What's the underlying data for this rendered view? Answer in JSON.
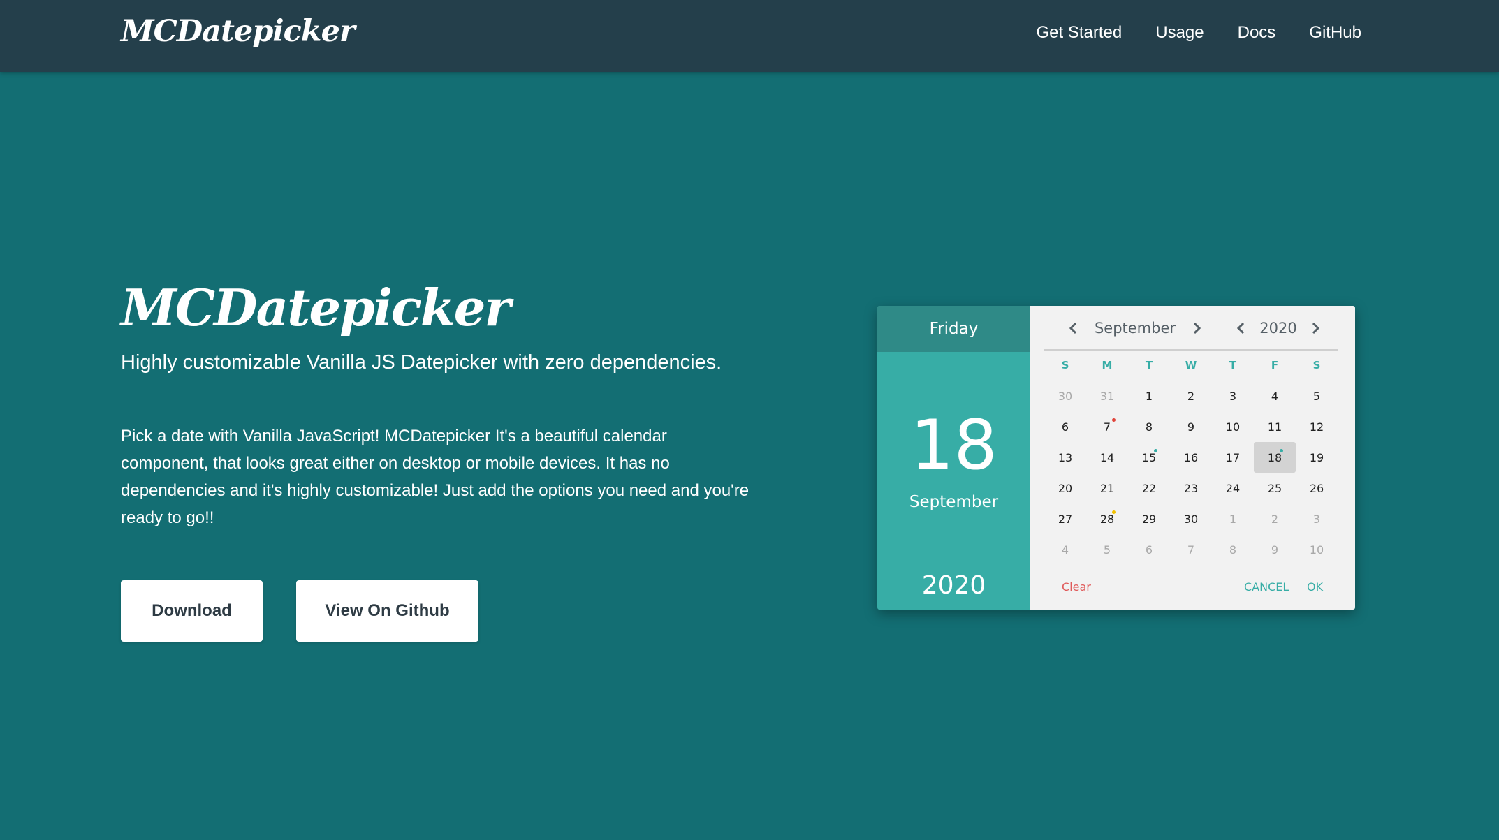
{
  "header": {
    "brand": "MCDatepicker",
    "nav": [
      "Get Started",
      "Usage",
      "Docs",
      "GitHub"
    ]
  },
  "hero": {
    "title": "MCDatepicker",
    "subtitle": "Highly customizable Vanilla JS Datepicker with zero dependencies.",
    "description": "Pick a date with Vanilla JavaScript! MCDatepicker It's a beautiful calendar component, that looks great either on desktop or mobile devices. It has no dependencies and it's highly customizable! Just add the options you need and you're ready to go!!",
    "buttons": {
      "download": "Download",
      "github": "View On Github"
    }
  },
  "datepicker": {
    "weekday": "Friday",
    "date": "18",
    "month": "September",
    "year": "2020",
    "month_label": "September",
    "year_label": "2020",
    "weekdays": [
      "S",
      "M",
      "T",
      "W",
      "T",
      "F",
      "S"
    ],
    "days": [
      {
        "n": "30",
        "other": true
      },
      {
        "n": "31",
        "other": true
      },
      {
        "n": "1"
      },
      {
        "n": "2"
      },
      {
        "n": "3"
      },
      {
        "n": "4"
      },
      {
        "n": "5"
      },
      {
        "n": "6"
      },
      {
        "n": "7",
        "dot": "red"
      },
      {
        "n": "8"
      },
      {
        "n": "9"
      },
      {
        "n": "10"
      },
      {
        "n": "11"
      },
      {
        "n": "12"
      },
      {
        "n": "13"
      },
      {
        "n": "14"
      },
      {
        "n": "15",
        "dot": "teal"
      },
      {
        "n": "16"
      },
      {
        "n": "17"
      },
      {
        "n": "18",
        "selected": true,
        "dot": "teal"
      },
      {
        "n": "19"
      },
      {
        "n": "20"
      },
      {
        "n": "21"
      },
      {
        "n": "22"
      },
      {
        "n": "23"
      },
      {
        "n": "24"
      },
      {
        "n": "25"
      },
      {
        "n": "26"
      },
      {
        "n": "27"
      },
      {
        "n": "28",
        "dot": "yellow"
      },
      {
        "n": "29"
      },
      {
        "n": "30"
      },
      {
        "n": "1",
        "other": true
      },
      {
        "n": "2",
        "other": true
      },
      {
        "n": "3",
        "other": true
      },
      {
        "n": "4",
        "other": true
      },
      {
        "n": "5",
        "other": true
      },
      {
        "n": "6",
        "other": true
      },
      {
        "n": "7",
        "other": true
      },
      {
        "n": "8",
        "other": true
      },
      {
        "n": "9",
        "other": true
      },
      {
        "n": "10",
        "other": true
      }
    ],
    "actions": {
      "clear": "Clear",
      "cancel": "CANCEL",
      "ok": "OK"
    },
    "icons": {
      "prev": "chevron-left-icon",
      "next": "chevron-right-icon"
    }
  },
  "colors": {
    "background": "#136e73",
    "header": "#243f4b",
    "accent": "#37ada6",
    "accent_dark": "#2f8a87",
    "clear": "#e05a5a"
  }
}
